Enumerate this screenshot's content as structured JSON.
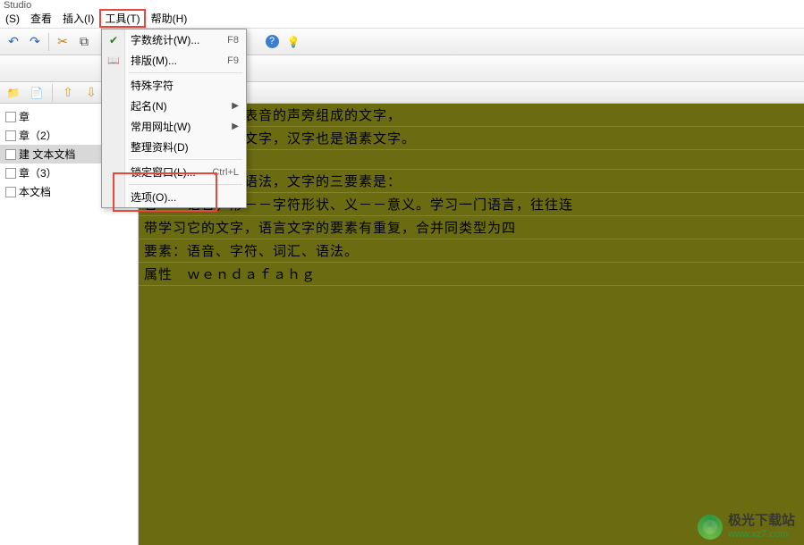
{
  "title": "Studio",
  "menubar": {
    "partial1": "(S)",
    "view": "查看",
    "insert": "插入(I)",
    "tools": "工具(T)",
    "help": "帮助(H)"
  },
  "dropdown": {
    "wordcount": {
      "label": "字数统计(W)...",
      "shortcut": "F8"
    },
    "typeset": {
      "label": "排版(M)...",
      "shortcut": "F9"
    },
    "specialchars": "特殊字符",
    "naming": "起名(N)",
    "commonurls": "常用网址(W)",
    "organize": "整理资料(D)",
    "lockwindow": {
      "label": "锁定窗口(L)...",
      "shortcut": "Ctrl+L"
    },
    "options": "选项(O)..."
  },
  "tree": {
    "items": [
      "章",
      "章（2）",
      "建 文本文档",
      "章（3）",
      "本文档"
    ]
  },
  "editor": {
    "lines": [
      "义的象形符号和表音的声旁组成的文字，",
      "字进化成的意音文字，汉字也是语素文字。",
      "",
      "：语音、词汇和语法，文字的三要素是：",
      "音－－语音，形－－字符形状、义－－意义。学习一门语言，往往连",
      "带学习它的文字，语言文字的要素有重复，合并同类型为四",
      "要素：语音、字符、词汇、语法。",
      "属性　ｗｅｎｄａｆａｈｇ"
    ]
  },
  "watermark": {
    "name": "极光下载站",
    "url": "www.xz7.com"
  },
  "icons": {
    "undo": "↶",
    "redo": "↷",
    "cut": "✂",
    "copy": "⧉",
    "paste": "📋",
    "help": "?",
    "bulb": "💡",
    "folder_add": "📁",
    "page_add": "📄",
    "up": "⇧",
    "down": "⇩",
    "lock": "🔒",
    "check": "✔",
    "book": "📖"
  }
}
